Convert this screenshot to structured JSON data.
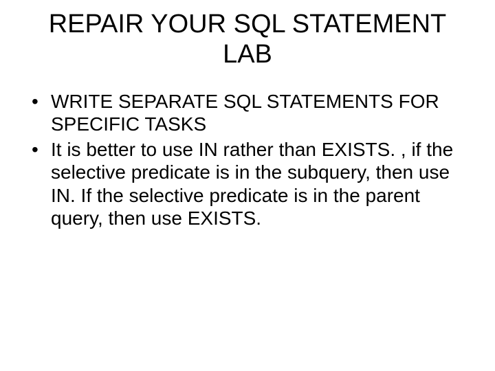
{
  "slide": {
    "title": "REPAIR YOUR SQL STATEMENT LAB",
    "bullets": [
      "WRITE SEPARATE SQL STATEMENTS FOR SPECIFIC TASKS",
      "It is better to use IN rather than EXISTS. , if the selective predicate is in the subquery, then use IN. If the selective predicate is in the parent query, then use EXISTS."
    ]
  }
}
